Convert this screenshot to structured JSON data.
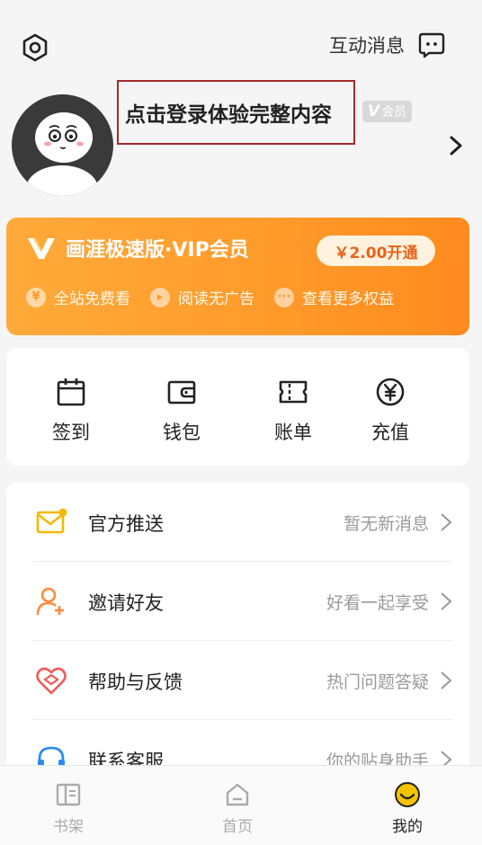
{
  "header": {
    "messages_label": "互动消息"
  },
  "profile": {
    "login_prompt": "点击登录体验完整内容",
    "vip_badge_letter": "V",
    "vip_badge_text": "会员"
  },
  "vip_card": {
    "title": "画涯极速版·VIP会员",
    "open_button": "￥2.00开通",
    "benefits": [
      {
        "label": "全站免费看",
        "icon": "free-icon"
      },
      {
        "label": "阅读无广告",
        "icon": "no-ads-icon"
      },
      {
        "label": "查看更多权益",
        "icon": "more-icon"
      }
    ]
  },
  "quick_actions": [
    {
      "label": "签到",
      "icon": "calendar-icon"
    },
    {
      "label": "钱包",
      "icon": "wallet-icon"
    },
    {
      "label": "账单",
      "icon": "ticket-icon"
    },
    {
      "label": "充值",
      "icon": "yen-coin-icon"
    }
  ],
  "menu": [
    {
      "label": "官方推送",
      "hint": "暂无新消息",
      "icon": "mail-icon",
      "color": "#f5b800"
    },
    {
      "label": "邀请好友",
      "hint": "好看一起享受",
      "icon": "invite-user-icon",
      "color": "#ff8a3d"
    },
    {
      "label": "帮助与反馈",
      "hint": "热门问题答疑",
      "icon": "heart-help-icon",
      "color": "#f05a5a"
    },
    {
      "label": "联系客服",
      "hint": "你的贴身助手",
      "icon": "headset-icon",
      "color": "#2a8cf0"
    }
  ],
  "tabbar": [
    {
      "label": "书架",
      "icon": "bookshelf-icon",
      "active": false
    },
    {
      "label": "首页",
      "icon": "home-icon",
      "active": false
    },
    {
      "label": "我的",
      "icon": "smiley-icon",
      "active": true
    }
  ],
  "colors": {
    "vip_gradient_start": "#ffaa3a",
    "vip_gradient_end": "#ff8a1e",
    "accent_yellow": "#f5c400"
  }
}
